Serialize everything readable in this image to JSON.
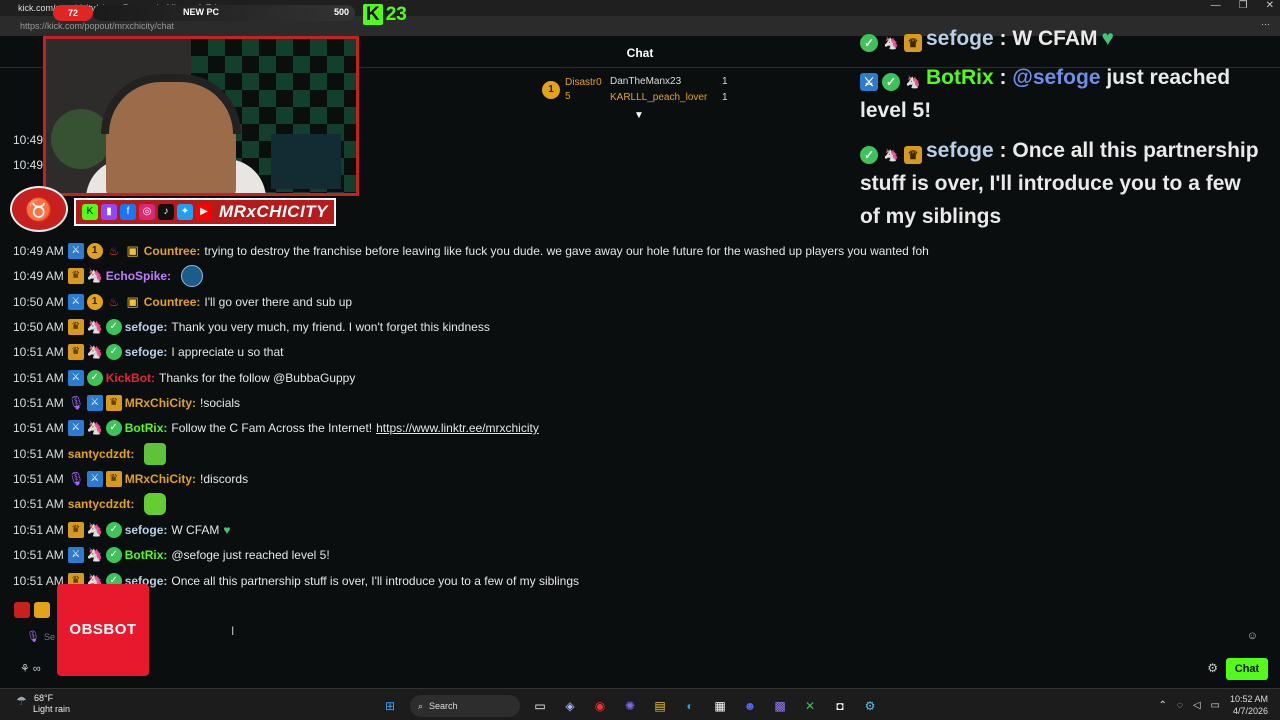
{
  "browser": {
    "tab_title": "kick.com/mrxchicity/chat - Personal - Microsoft Edge",
    "url": "https://kick.com/popout/mrxchicity/chat",
    "more": "⋯"
  },
  "chat": {
    "header": "Chat",
    "leaderboard": {
      "rank_badge": "1",
      "top_name": "Disastr0",
      "top_count": "5",
      "rows": [
        {
          "name": "DanTheManx23",
          "count": "1"
        },
        {
          "name": "KARLLL_peach_lover",
          "count": "1"
        }
      ]
    },
    "partial_times": [
      "10:49",
      "10:49"
    ],
    "messages": [
      {
        "time": "10:49 AM",
        "user": "Countree:",
        "text": "trying to destroy the franchise before leaving like fuck you dude. we gave away our hole future for the washed up players you wanted foh"
      },
      {
        "time": "10:49 AM",
        "user": "EchoSpike:",
        "text": ""
      },
      {
        "time": "10:50 AM",
        "user": "Countree:",
        "text": "I'll go over there and sub up"
      },
      {
        "time": "10:50 AM",
        "user": "sefoge:",
        "text": "Thank you very much, my friend. I won't forget this kindness"
      },
      {
        "time": "10:51 AM",
        "user": "sefoge:",
        "text": "I appreciate u so that"
      },
      {
        "time": "10:51 AM",
        "user": "KickBot:",
        "text": "Thanks for the follow @BubbaGuppy"
      },
      {
        "time": "10:51 AM",
        "user": "MRxChiCity:",
        "text": "!socials"
      },
      {
        "time": "10:51 AM",
        "user": "BotRix:",
        "text": "Follow the C Fam Across the Internet!",
        "link": "https://www.linktr.ee/mrxchicity"
      },
      {
        "time": "10:51 AM",
        "user": "santycdzdt:",
        "text": ""
      },
      {
        "time": "10:51 AM",
        "user": "MRxChiCity:",
        "text": "!discords"
      },
      {
        "time": "10:51 AM",
        "user": "santycdzdt:",
        "text": ""
      },
      {
        "time": "10:51 AM",
        "user": "sefoge:",
        "text": "W CFAM"
      },
      {
        "time": "10:51 AM",
        "user": "BotRix:",
        "text": "@sefoge just reached level 5!"
      },
      {
        "time": "10:51 AM",
        "user": "sefoge:",
        "text": "Once all this partnership stuff is over, I'll introduce you to a few of my siblings"
      }
    ],
    "input_placeholder": "Se",
    "send_label": "Chat"
  },
  "overlay_stream": {
    "goal_current": "72",
    "goal_label": "NEW PC",
    "goal_target": "500",
    "kick_followers": "23",
    "brand_name": "MRxCHICITY",
    "obsbot_label": "OBSBOT",
    "rows": [
      {
        "user": "sefoge",
        "sep": " : ",
        "text": "W CFAM"
      },
      {
        "user": "BotRix",
        "sep": " : ",
        "mention": "@sefoge",
        "text": " just reached level 5!"
      },
      {
        "user": "sefoge",
        "sep": " : ",
        "text": "Once all this partnership stuff is over, I'll introduce you to a few of my siblings"
      }
    ]
  },
  "taskbar": {
    "temperature": "68°F",
    "weather": "Light rain",
    "search": "Search",
    "time": "10:52 AM",
    "date": "4/7/2026"
  },
  "colors": {
    "kick_green": "#53fc18",
    "gold": "#e3a21a",
    "mod_blue": "#2b7bd1",
    "verified_green": "#3ec25a",
    "kickbot_red": "#e8203a",
    "botrix_green": "#53fc18",
    "sefoge_blue": "#b8cfe8",
    "echospike_purple": "#c07dff"
  }
}
